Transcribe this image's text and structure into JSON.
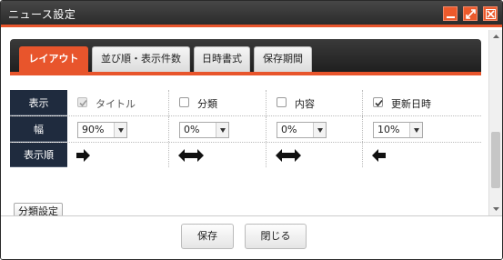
{
  "window": {
    "title": "ニュース設定",
    "controls": [
      "minimize-icon",
      "maximize-icon",
      "close-icon"
    ],
    "accent_color": "#e8552c"
  },
  "tabs": [
    {
      "label": "レイアウト",
      "active": true
    },
    {
      "label": "並び順・表示件数",
      "active": false
    },
    {
      "label": "日時書式",
      "active": false
    },
    {
      "label": "保存期間",
      "active": false
    }
  ],
  "grid": {
    "row_headers": {
      "display": "表示",
      "width": "幅",
      "order": "表示順"
    },
    "columns": [
      {
        "label": "タイトル",
        "checked": true,
        "disabled": true,
        "width": "90%",
        "order_icon": "arrow-right-icon"
      },
      {
        "label": "分類",
        "checked": false,
        "disabled": false,
        "width": "0%",
        "order_icon": "arrow-both-icon"
      },
      {
        "label": "内容",
        "checked": false,
        "disabled": false,
        "width": "0%",
        "order_icon": "arrow-both-icon"
      },
      {
        "label": "更新日時",
        "checked": true,
        "disabled": false,
        "width": "10%",
        "order_icon": "arrow-left-icon"
      }
    ]
  },
  "category_settings_label": "分類設定",
  "footer": {
    "save_label": "保存",
    "close_label": "閉じる"
  }
}
